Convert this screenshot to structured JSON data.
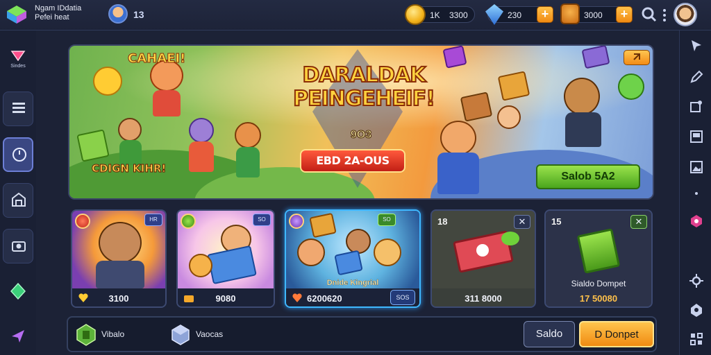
{
  "header": {
    "app_title_line1": "Ngam IDdatia",
    "app_title_line2": "Pefei heat",
    "player_level": "13",
    "currencies": [
      {
        "icon": "gold-coin-icon",
        "value_a": "1K",
        "value_b": "3300"
      },
      {
        "icon": "blue-gem-icon",
        "value": "230",
        "add": "+"
      },
      {
        "icon": "treasure-chest-icon",
        "value": "3000",
        "add": "+"
      }
    ]
  },
  "sidebar_left": {
    "items": [
      {
        "icon": "heart-gem-icon",
        "label": "Sindes"
      },
      {
        "icon": "list-icon",
        "label": ""
      },
      {
        "icon": "clock-icon",
        "label": ""
      },
      {
        "icon": "store-icon",
        "label": ""
      },
      {
        "icon": "camera-icon",
        "label": ""
      },
      {
        "icon": "green-diamond-icon",
        "label": ""
      },
      {
        "icon": "send-icon",
        "label": ""
      }
    ]
  },
  "banner": {
    "title_line1": "DARALDAK",
    "title_line2": "PEINGEHEIF!",
    "score": "9O3",
    "event_label": "EBD 2A-OUS",
    "sub_left": "CAHAEI!",
    "sub_bottom": "CDIGN KIHR!",
    "cta_label": "Salob 5A2"
  },
  "cards": [
    {
      "kind": "character",
      "badge": "HR",
      "price": "3100",
      "selected": false
    },
    {
      "kind": "character",
      "badge": "SO",
      "price": "9080",
      "selected": false
    },
    {
      "kind": "bundle",
      "badge": "SO",
      "caption": "Dnide Kingrial",
      "price": "6200620",
      "chip": "SOS",
      "selected": true
    },
    {
      "kind": "item",
      "number": "18",
      "close": "✕",
      "price": "311 8000",
      "selected": false
    },
    {
      "kind": "item",
      "number": "15",
      "close": "✕",
      "caption": "Sialdo Dompet",
      "price": "17 50080",
      "selected": false
    }
  ],
  "bottom_bar": {
    "item1_label": "Vibalo",
    "item2_label": "Vaocas",
    "secondary_button": "Saldo",
    "primary_button": "D Donpet"
  },
  "colors": {
    "background": "#1c2236",
    "accent_orange": "#f08b12",
    "accent_green": "#4aa51d",
    "selected_border": "#3fb8ff"
  }
}
